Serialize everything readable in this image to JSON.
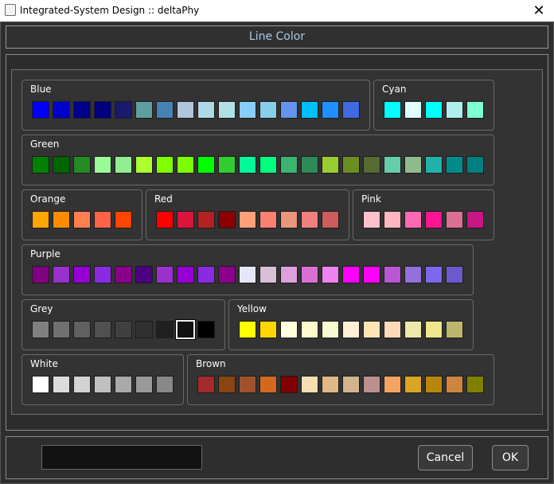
{
  "window": {
    "title": "Integrated-System Design :: deltaPhy",
    "close_glyph": "✕"
  },
  "dialog": {
    "header": "Line Color"
  },
  "groups": [
    {
      "name": "Blue",
      "colors": [
        "#0000FF",
        "#0000CD",
        "#00008B",
        "#000080",
        "#191970",
        "#5F9EA0",
        "#4682B4",
        "#B0C4DE",
        "#ADD8E6",
        "#B0E0E6",
        "#87CEFA",
        "#87CEEB",
        "#6495ED",
        "#00BFFF",
        "#1E90FF",
        "#4169E1"
      ]
    },
    {
      "name": "Cyan",
      "colors": [
        "#00FFFF",
        "#E0FFFF",
        "#00FFFF",
        "#AFEEEE",
        "#7FFFD4"
      ]
    },
    {
      "name": "Green",
      "colors": [
        "#008000",
        "#006400",
        "#228B22",
        "#98FB98",
        "#90EE90",
        "#ADFF2F",
        "#7FFF00",
        "#7CFC00",
        "#00FF00",
        "#32CD32",
        "#00FA9A",
        "#00FF7F",
        "#3CB371",
        "#2E8B57",
        "#9ACD32",
        "#6B8E23",
        "#556B2F",
        "#66CDAA",
        "#8FBC8F",
        "#20B2AA",
        "#008B8B",
        "#008080"
      ]
    },
    {
      "name": "Orange",
      "colors": [
        "#FFA500",
        "#FF8C00",
        "#FF7F50",
        "#FF6347",
        "#FF4500"
      ]
    },
    {
      "name": "Red",
      "colors": [
        "#FF0000",
        "#DC143C",
        "#B22222",
        "#8B0000",
        "#FFA07A",
        "#FA8072",
        "#E9967A",
        "#F08080",
        "#CD5C5C"
      ]
    },
    {
      "name": "Pink",
      "colors": [
        "#FFC0CB",
        "#FFB6C1",
        "#FF69B4",
        "#FF1493",
        "#DB7093",
        "#C71585"
      ]
    },
    {
      "name": "Purple",
      "colors": [
        "#800080",
        "#9932CC",
        "#9400D3",
        "#8A2BE2",
        "#8B008B",
        "#4B0082",
        "#9932CC",
        "#9400D3",
        "#8A2BE2",
        "#8B008B",
        "#E6E6FA",
        "#D8BFD8",
        "#DDA0DD",
        "#DA70D6",
        "#EE82EE",
        "#FF00FF",
        "#FF00FF",
        "#BA55D3",
        "#9370DB",
        "#7B68EE",
        "#6A5ACD"
      ]
    },
    {
      "name": "Grey",
      "colors": [
        "#808080",
        "#707070",
        "#606060",
        "#505050",
        "#404040",
        "#303030",
        "#202020",
        "#111111",
        "#000000"
      ],
      "selected_index": 7
    },
    {
      "name": "Yellow",
      "colors": [
        "#FFFF00",
        "#FFD700",
        "#FFFFE0",
        "#FFFACD",
        "#FAFAD2",
        "#FFEFD5",
        "#FFE4B5",
        "#FFDAB9",
        "#EEE8AA",
        "#F0E68C",
        "#BDB76B"
      ]
    },
    {
      "name": "White",
      "colors": [
        "#FFFFFF",
        "#DCDCDC",
        "#D3D3D3",
        "#C0C0C0",
        "#A9A9A9",
        "#999999",
        "#888888"
      ]
    },
    {
      "name": "Brown",
      "colors": [
        "#A52A2A",
        "#8B4513",
        "#A0522D",
        "#D2691E",
        "#800000",
        "#F5DEB3",
        "#DEB887",
        "#D2B48C",
        "#BC8F8F",
        "#F4A460",
        "#DAA520",
        "#B8860B",
        "#CD853F",
        "#808000"
      ]
    }
  ],
  "footer": {
    "preview_color": "#121212",
    "cancel_label": "Cancel",
    "ok_label": "OK"
  }
}
